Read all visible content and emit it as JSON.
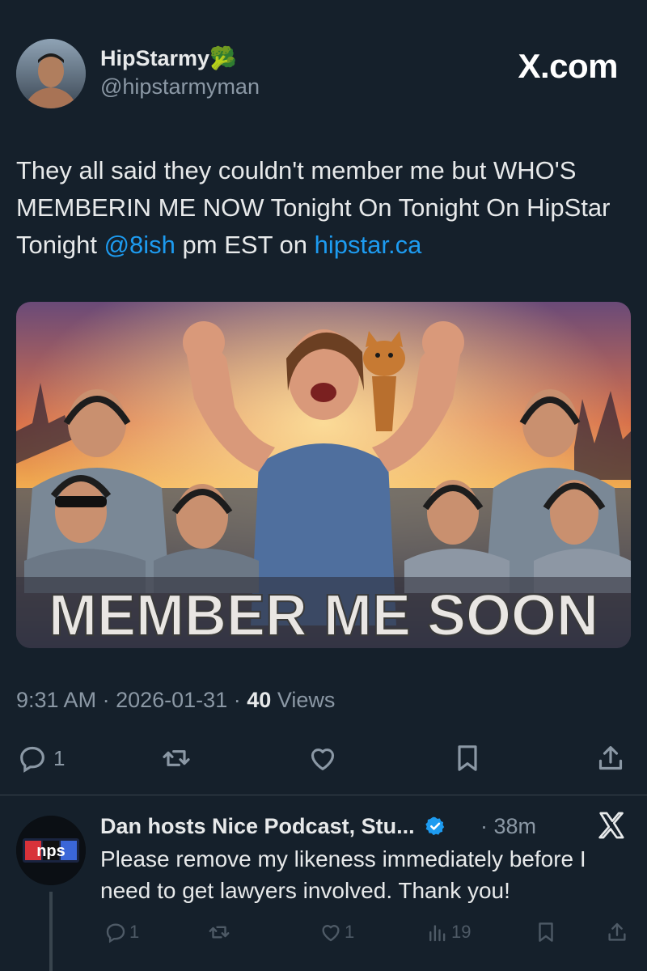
{
  "post": {
    "author_name": "HipStarmy",
    "author_emoji": "🥦",
    "author_handle": "@hipstarmyman",
    "brand": "X.com",
    "text_part1": "They all said they couldn't member me but WHO'S MEMBERIN ME NOW Tonight On Tonight On HipStar Tonight ",
    "mention": "@8ish",
    "text_part2": " pm EST on ",
    "link": "hipstar.ca",
    "image_caption": "MEMBER ME SOON",
    "time": "9:31 AM",
    "sep": "·",
    "date": "2026-01-31",
    "views_count": "40",
    "views_label": "Views",
    "reply_count": "1"
  },
  "reply": {
    "avatar_text": "nps",
    "author_name": "Dan hosts Nice Podcast, Stu...",
    "time": "· 38m",
    "text": "Please remove my likeness immediately before I need to get lawyers involved. Thank you!",
    "reply_count": "1",
    "like_count": "1",
    "views_count": "19"
  },
  "colors": {
    "background": "#15202b",
    "link": "#1d9bf0",
    "muted": "#8b98a5",
    "verified": "#1d9bf0"
  }
}
